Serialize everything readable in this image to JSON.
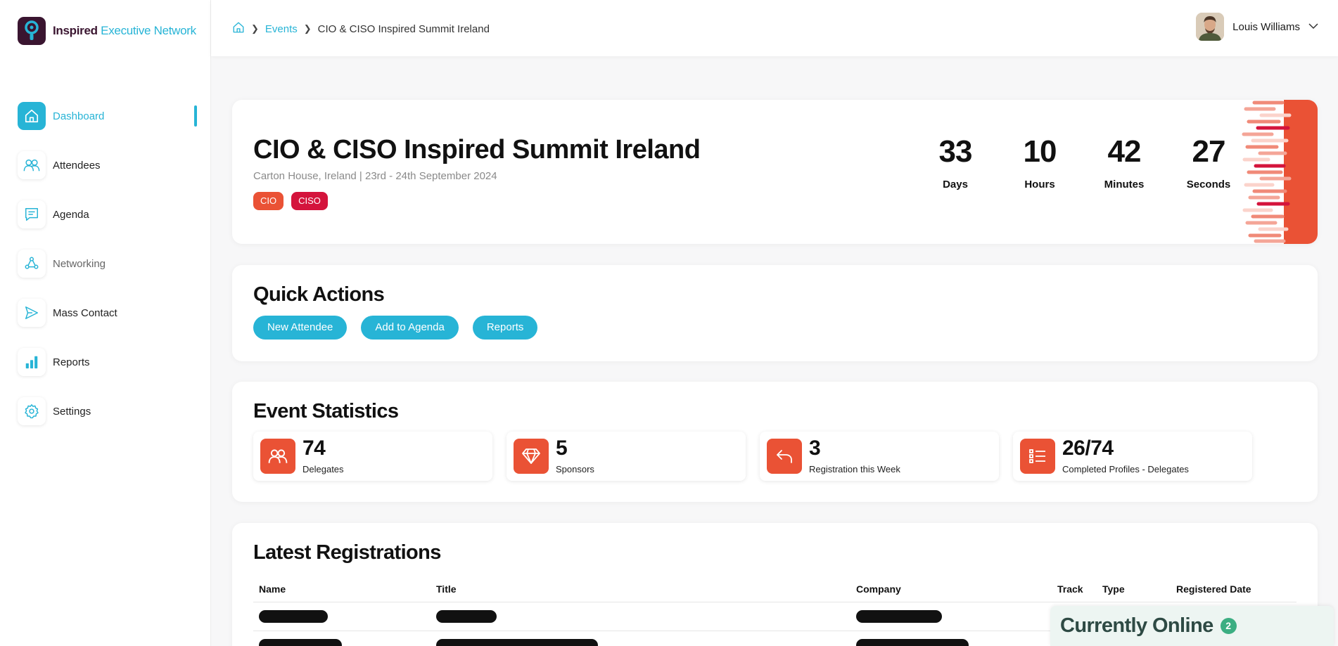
{
  "brand": {
    "name_primary": "Inspired",
    "name_secondary": "Executive Network",
    "color": "#27b4d6"
  },
  "sidebar": {
    "items": [
      {
        "label": "Dashboard",
        "icon": "home-icon",
        "active": true
      },
      {
        "label": "Attendees",
        "icon": "users-icon"
      },
      {
        "label": "Agenda",
        "icon": "agenda-icon"
      },
      {
        "label": "Networking",
        "icon": "networking-icon"
      },
      {
        "label": "Mass Contact",
        "icon": "send-icon"
      },
      {
        "label": "Reports",
        "icon": "bar-chart-icon"
      },
      {
        "label": "Settings",
        "icon": "gear-icon"
      }
    ]
  },
  "header": {
    "breadcrumb": {
      "home_icon": "home-icon",
      "events": "Events",
      "current": "CIO & CISO Inspired Summit Ireland"
    },
    "user": {
      "name": "Louis Williams"
    }
  },
  "event": {
    "title": "CIO & CISO Inspired Summit Ireland",
    "subtitle": "Carton House, Ireland | 23rd - 24th September 2024",
    "tags": [
      {
        "label": "CIO",
        "color": "#ea5235"
      },
      {
        "label": "CISO",
        "color": "#d4143c"
      }
    ],
    "countdown": [
      {
        "value": "33",
        "label": "Days"
      },
      {
        "value": "10",
        "label": "Hours"
      },
      {
        "value": "42",
        "label": "Minutes"
      },
      {
        "value": "27",
        "label": "Seconds"
      }
    ]
  },
  "quick_actions": {
    "title": "Quick Actions",
    "buttons": [
      "New Attendee",
      "Add to Agenda",
      "Reports"
    ]
  },
  "event_statistics": {
    "title": "Event Statistics",
    "stats": [
      {
        "value": "74",
        "label": "Delegates",
        "icon": "users-icon"
      },
      {
        "value": "5",
        "label": "Sponsors",
        "icon": "diamond-icon"
      },
      {
        "value": "3",
        "label": "Registration this Week",
        "icon": "reply-arrow-icon"
      },
      {
        "value": "26/74",
        "label": "Completed Profiles - Delegates",
        "icon": "list-icon"
      }
    ]
  },
  "latest_registrations": {
    "title": "Latest Registrations",
    "columns": [
      "Name",
      "Title",
      "Company",
      "Track",
      "Type",
      "Registered Date"
    ]
  },
  "currently_online": {
    "label": "Currently Online",
    "count": "2"
  }
}
